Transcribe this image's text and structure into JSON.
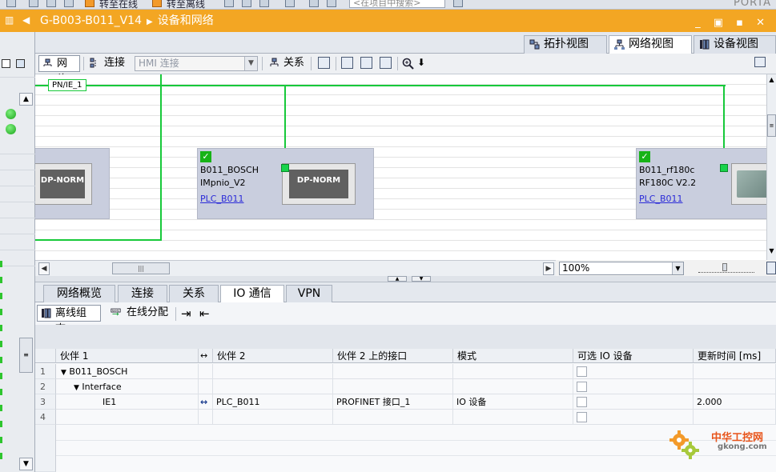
{
  "top_bar": {
    "text_1": "转至在线",
    "text_2": "转至离线",
    "search_placeholder": "<在项目中搜索>",
    "brand": "PORTA"
  },
  "title_bar": {
    "device": "G-B003-B011_V14",
    "section": "设备和网络",
    "window_controls": "_ ▣ ▪ ✕"
  },
  "view_tabs": [
    {
      "label": "拓扑视图",
      "active": false,
      "icon": "topology-icon"
    },
    {
      "label": "网络视图",
      "active": true,
      "icon": "network-icon"
    },
    {
      "label": "设备视图",
      "active": false,
      "icon": "device-icon"
    }
  ],
  "toolbar": {
    "network_label": "网络",
    "connect_label": "连接",
    "hmi_select_value": "HMI 连接",
    "relation_label": "关系"
  },
  "canvas": {
    "subnet_label": "PN/IE_1",
    "devices": [
      {
        "module_label": "DP-NORM"
      },
      {
        "name": "B011_BOSCH",
        "type": "IMpnio_V2",
        "link": "PLC_B011",
        "module_label": "DP-NORM"
      },
      {
        "name": "B011_rf180c",
        "type": "RF180C V2.2",
        "link": "PLC_B011"
      }
    ],
    "zoom": "100%"
  },
  "bottom_tabs": [
    {
      "label": "网络概览",
      "active": false
    },
    {
      "label": "连接",
      "active": false
    },
    {
      "label": "关系",
      "active": false
    },
    {
      "label": "IO 通信",
      "active": true
    },
    {
      "label": "VPN",
      "active": false
    }
  ],
  "bottom_toolbar": {
    "offline_config": "离线组态",
    "online_assign": "在线分配"
  },
  "table": {
    "headers": [
      "伙伴 1",
      "伙伴 2",
      "伙伴 2 上的接口",
      "模式",
      "可选 IO 设备",
      "更新时间 [ms]"
    ],
    "rows": [
      {
        "num": "1",
        "partner1": "B011_BOSCH",
        "partner2": "",
        "interface": "",
        "mode": "",
        "update": ""
      },
      {
        "num": "2",
        "partner1": "Interface",
        "partner2": "",
        "interface": "",
        "mode": "",
        "update": ""
      },
      {
        "num": "3",
        "partner1": "IE1",
        "partner2": "PLC_B011",
        "interface": "PROFINET 接口_1",
        "mode": "IO 设备",
        "update": "2.000"
      },
      {
        "num": "4",
        "partner1": "",
        "partner2": "",
        "interface": "",
        "mode": "",
        "update": ""
      }
    ]
  },
  "watermark": {
    "title": "中华工控网",
    "url": "gkong.com"
  },
  "colors": {
    "accent_orange": "#f3a623",
    "subnet_green": "#17c93a",
    "device_box": "#c9cede",
    "link_blue": "#2a2ad8"
  }
}
